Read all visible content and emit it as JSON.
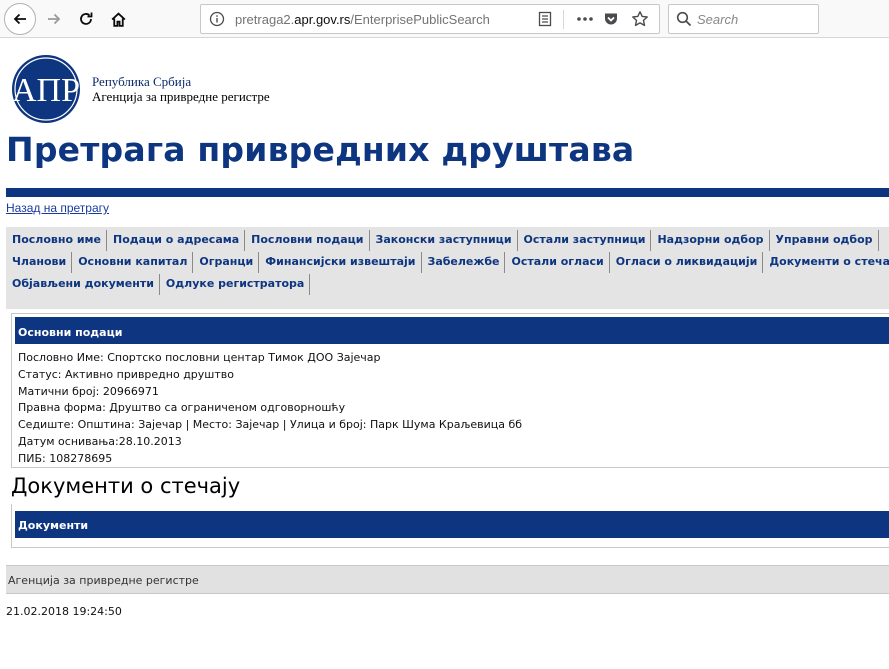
{
  "browser": {
    "url_prefix": "pretraga2.",
    "url_host": "apr.gov.rs",
    "url_path": "/EnterprisePublicSearch",
    "search_placeholder": "Search"
  },
  "header": {
    "logo_line1": "Република Србија",
    "logo_line2": "Агенција за привредне регистре",
    "title": "Претрага привредних друштава",
    "back_link": "Назад на претрагу"
  },
  "tabs": {
    "row1": [
      "Пословно име",
      "Подаци о адресама",
      "Пословни подаци",
      "Законски заступници",
      "Остали заступници",
      "Надзорни одбор",
      "Управни одбор"
    ],
    "row2": [
      "Чланови",
      "Основни капитал",
      "Огранци",
      "Финансијски извештаји",
      "Забележбе",
      "Остали огласи",
      "Огласи о ликвидацији",
      "Документи о стечају"
    ],
    "row3": [
      "Објављени документи",
      "Одлуке регистратора"
    ]
  },
  "basic_data": {
    "heading": "Основни подаци",
    "business_name": "Пословно Име: Спортско пословни центар Тимок ДОО Зајечар",
    "status": "Статус: Активно привредно друштво",
    "registration_number": "Матични број: 20966971",
    "legal_form": "Правна форма: Друштво са ограниченом одговорношћу",
    "seat": "Седиште: Општина: Зајечар | Место: Зајечар | Улица и број: Парк Шума Краљевица бб",
    "founding_date": "Датум оснивања:28.10.2013",
    "tax_id": "ПИБ: 108278695"
  },
  "bankruptcy": {
    "title": "Документи о стечају",
    "documents_heading": "Документи"
  },
  "footer": {
    "agency": "Агенција за привредне регистре",
    "timestamp": "21.02.2018 19:24:50"
  }
}
